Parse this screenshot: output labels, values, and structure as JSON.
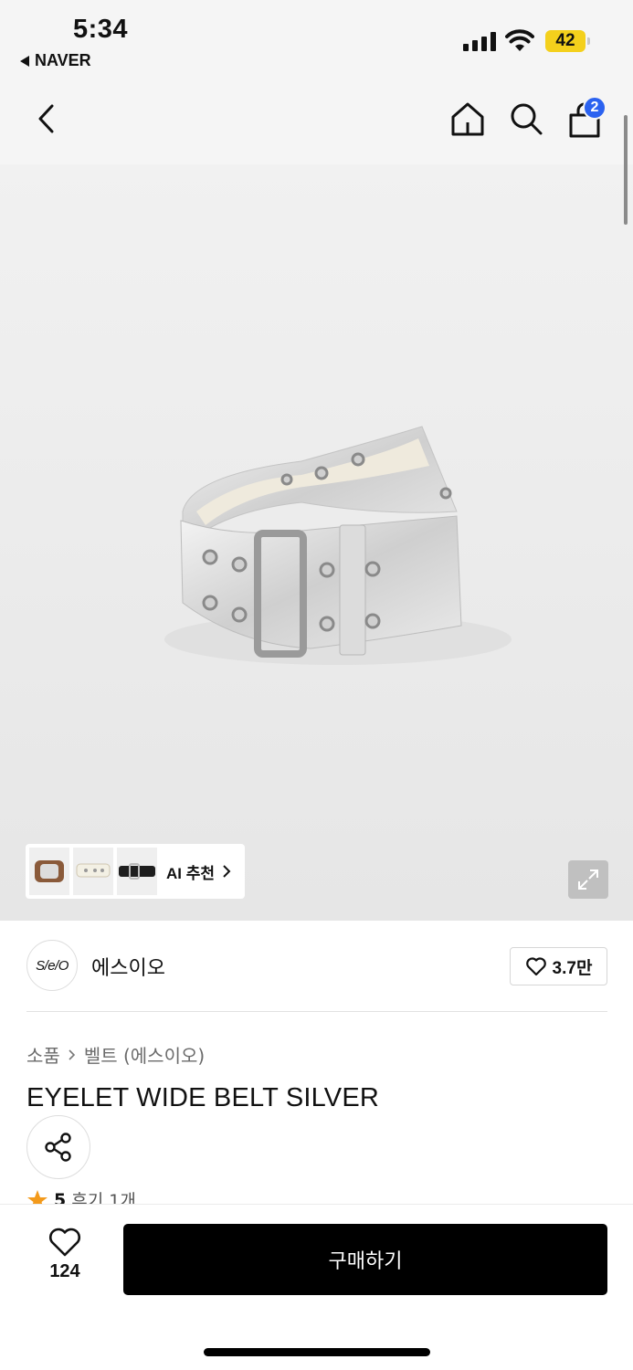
{
  "status_bar": {
    "time": "5:34",
    "back_app": "NAVER",
    "battery": "42",
    "battery_color": "#f4d01c"
  },
  "nav": {
    "back_icon": "chevron-left-icon",
    "home_icon": "home-icon",
    "search_icon": "search-icon",
    "cart_icon": "shopping-bag-icon",
    "cart_count": "2",
    "badge_color": "#2b62f0"
  },
  "gallery": {
    "ai_recommend_label": "AI 추천",
    "thumbnails": [
      "brown-belt-thumb",
      "white-belt-thumb",
      "black-belt-thumb"
    ],
    "expand_icon": "expand-icon"
  },
  "brand": {
    "logo_text": "S/e/O",
    "name": "에스이오",
    "favorites": "3.7만"
  },
  "product": {
    "breadcrumb": [
      "소품",
      "벨트 (에스이오)"
    ],
    "title": "EYELET WIDE BELT SILVER",
    "rating": "5",
    "reviews": "후기 1개"
  },
  "bottom": {
    "likes": "124",
    "buy_label": "구매하기",
    "buy_color": "#000000"
  }
}
